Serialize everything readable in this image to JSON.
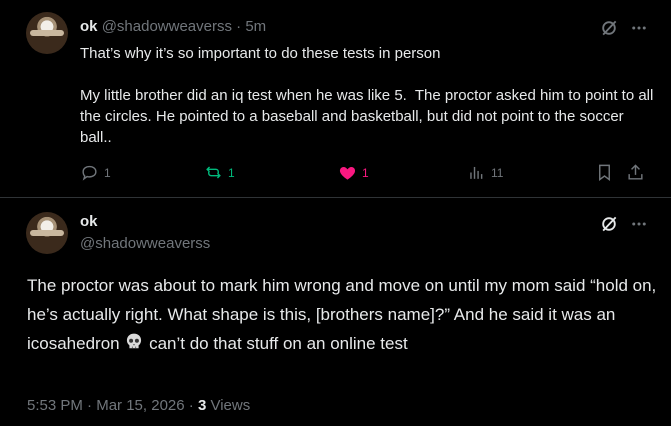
{
  "tweet1": {
    "author_name": "ok",
    "handle": "@shadowweaverss",
    "separator": " · ",
    "time": "5m",
    "text_line1": "That’s why it’s so important to do these tests in person",
    "text_para2": "My little brother did an iq test when he was like 5.  The proctor asked him to point to all the circles. He pointed to a baseball and basketball, but did not point to the soccer ball..",
    "replies": "1",
    "reposts": "1",
    "likes": "1",
    "views": "11",
    "colors": {
      "repost": "#00ba7c",
      "like": "#f91880",
      "muted": "#71767b"
    }
  },
  "tweet2": {
    "author_name": "ok",
    "handle": "@shadowweaverss",
    "text_before_emoji": "The proctor was about to mark him wrong and move on until my mom said “hold on, he’s actually right. What shape is this, [brothers name]?” And he said it was an icosahedron ",
    "emoji": "skull-icon",
    "text_after_emoji": " can’t do that stuff on an online test",
    "time": "5:53 PM",
    "date": "Mar 15, 2026",
    "views_count": "3",
    "views_label": "Views"
  }
}
